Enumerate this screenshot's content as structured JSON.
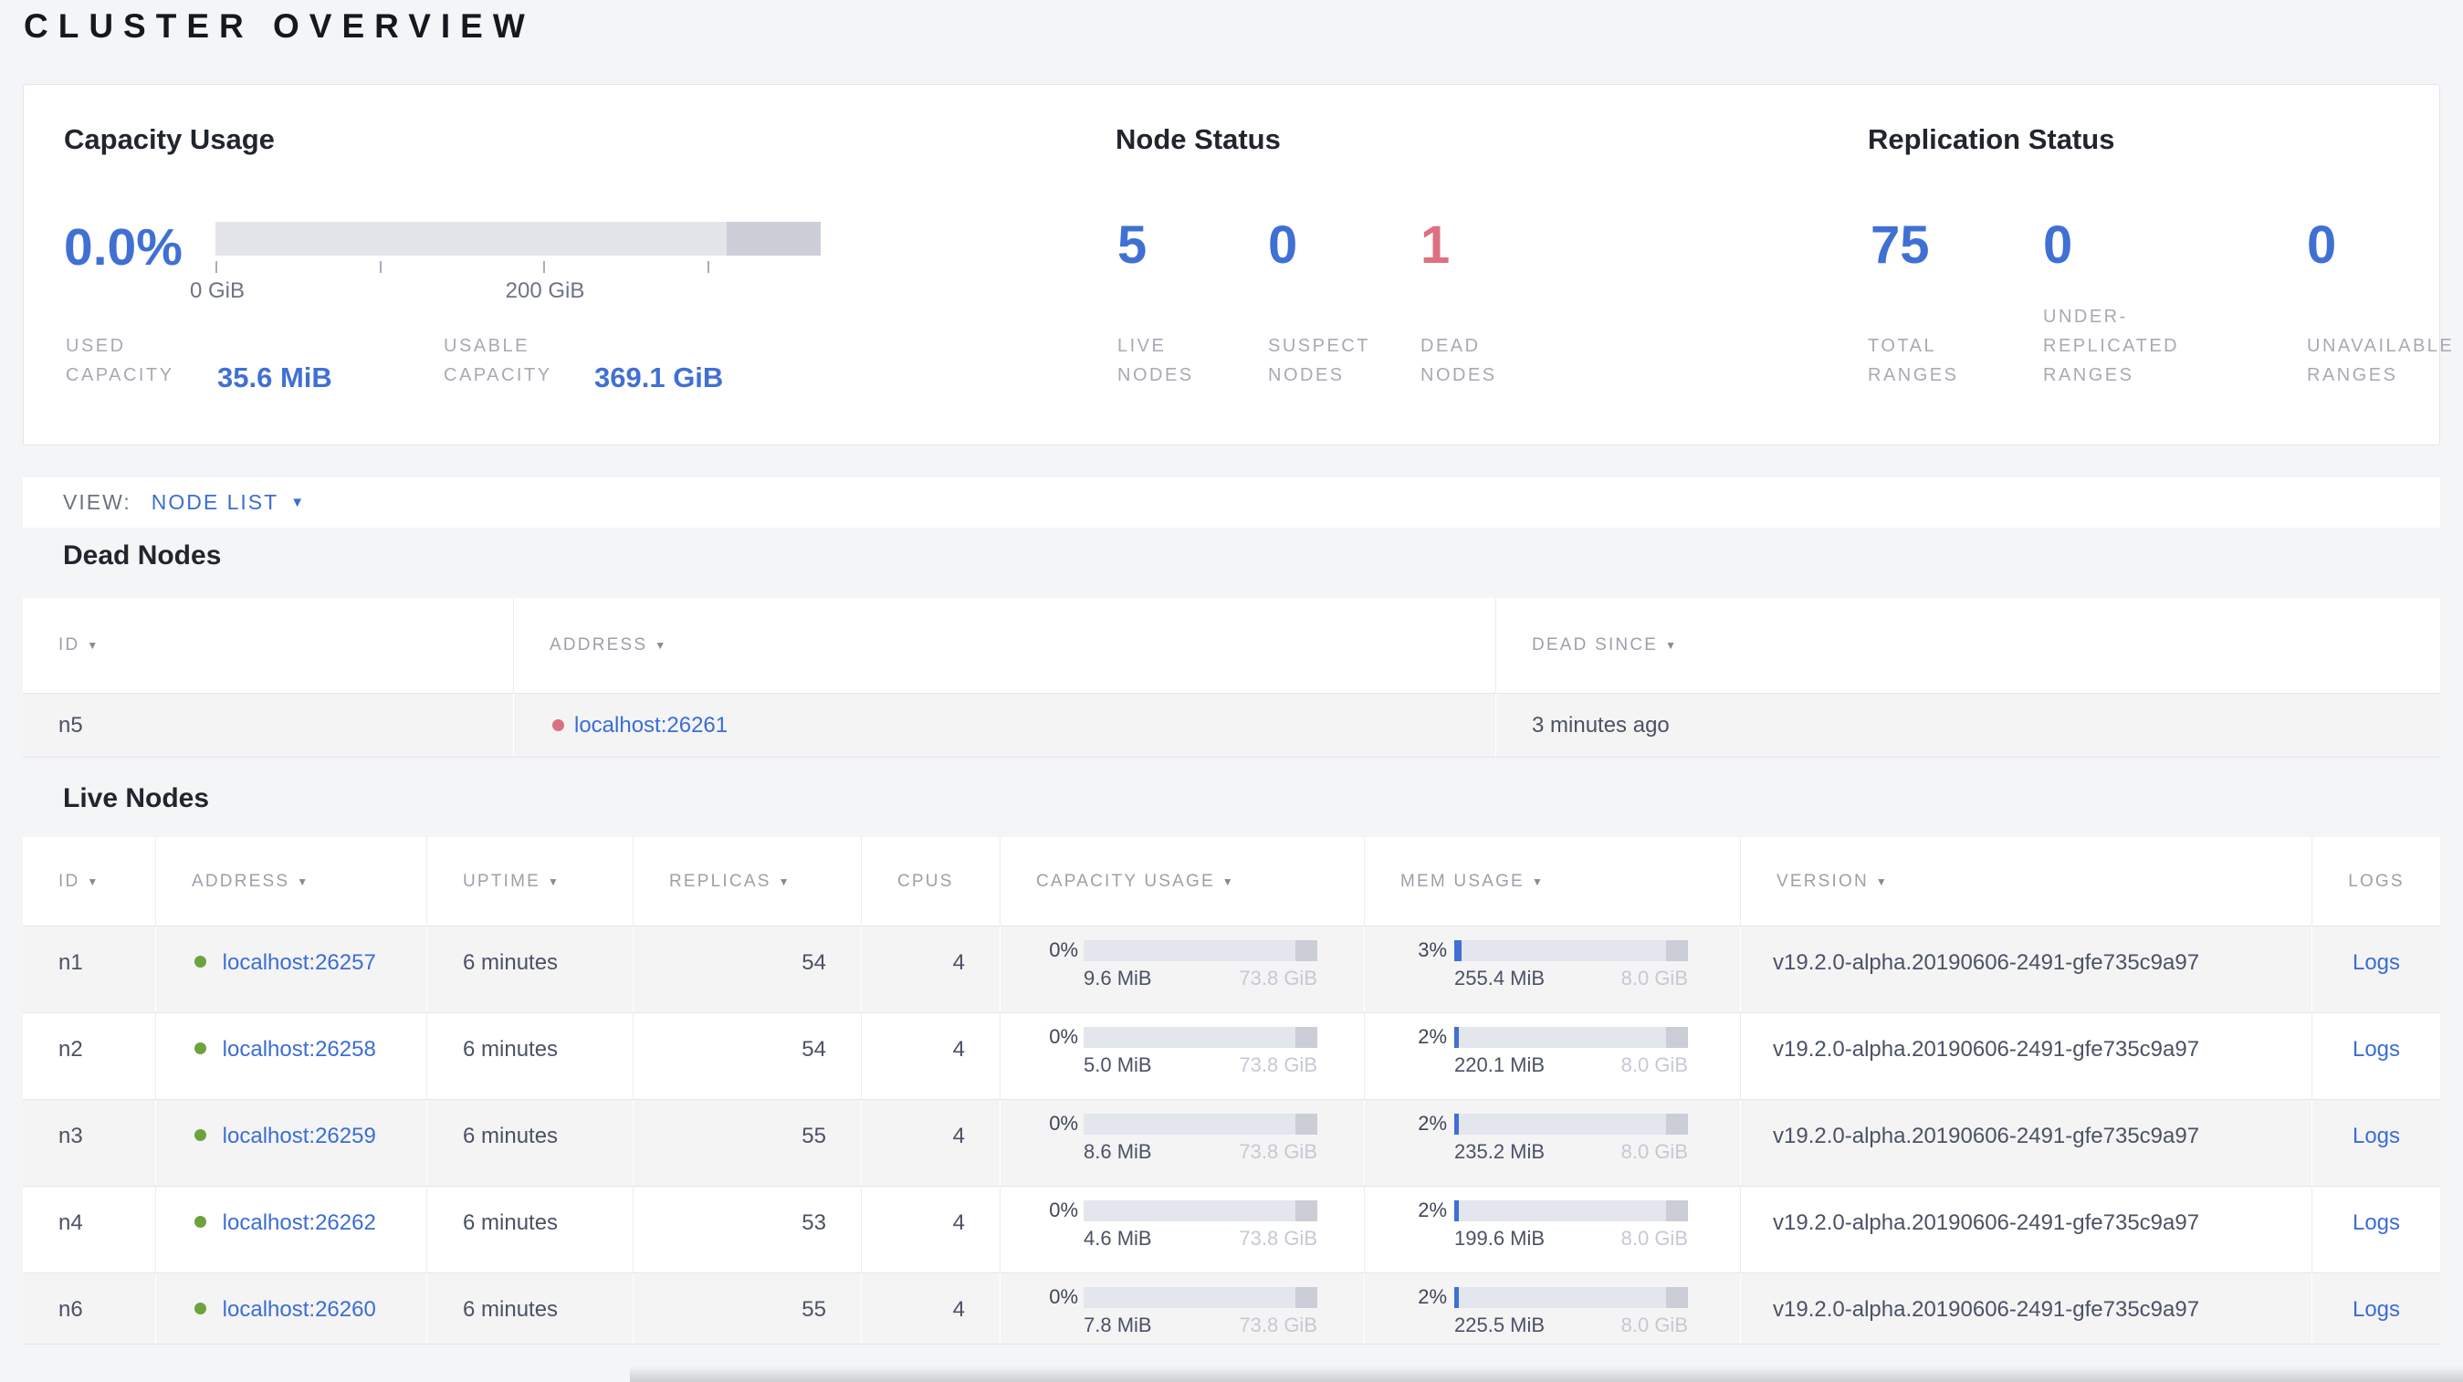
{
  "page_title": "CLUSTER OVERVIEW",
  "icons": {
    "sort_arrow": "▼",
    "dropdown_caret": "▼"
  },
  "colors": {
    "accent_blue": "#4070d4",
    "link_blue": "#3b6dd4",
    "dead_red": "#dd7080",
    "live_green": "#6da33c"
  },
  "summary": {
    "capacity": {
      "title": "Capacity Usage",
      "percent": "0.0%",
      "tick_labels": [
        "0 GiB",
        "200 GiB"
      ],
      "used": {
        "label": "USED CAPACITY",
        "value": "35.6 MiB"
      },
      "usable": {
        "label": "USABLE CAPACITY",
        "value": "369.1 GiB"
      }
    },
    "node_status": {
      "title": "Node Status",
      "live": {
        "value": "5",
        "label": "LIVE NODES"
      },
      "suspect": {
        "value": "0",
        "label": "SUSPECT NODES"
      },
      "dead": {
        "value": "1",
        "label": "DEAD NODES"
      }
    },
    "replication": {
      "title": "Replication Status",
      "total": {
        "value": "75",
        "label": "TOTAL RANGES"
      },
      "under_replicated": {
        "value": "0",
        "label": "UNDER-REPLICATED RANGES"
      },
      "unavailable": {
        "value": "0",
        "label": "UNAVAILABLE RANGES"
      }
    }
  },
  "view_bar": {
    "label": "VIEW:",
    "selected": "NODE LIST"
  },
  "dead_nodes": {
    "heading": "Dead Nodes",
    "columns": {
      "id": "ID",
      "address": "ADDRESS",
      "dead_since": "DEAD SINCE"
    },
    "rows": [
      {
        "id": "n5",
        "address": "localhost:26261",
        "dead_since": "3 minutes ago"
      }
    ]
  },
  "live_nodes": {
    "heading": "Live Nodes",
    "columns": {
      "id": "ID",
      "address": "ADDRESS",
      "uptime": "UPTIME",
      "replicas": "REPLICAS",
      "cpus": "CPUS",
      "capacity": "CAPACITY USAGE",
      "mem": "MEM USAGE",
      "version": "VERSION",
      "logs": "LOGS"
    },
    "logs_label": "Logs",
    "rows": [
      {
        "id": "n1",
        "address": "localhost:26257",
        "uptime": "6 minutes",
        "replicas": "54",
        "cpus": "4",
        "capacity": {
          "percent": "0%",
          "used": "9.6 MiB",
          "total": "73.8 GiB"
        },
        "mem": {
          "percent": "3%",
          "used": "255.4 MiB",
          "total": "8.0 GiB"
        },
        "version": "v19.2.0-alpha.20190606-2491-gfe735c9a97"
      },
      {
        "id": "n2",
        "address": "localhost:26258",
        "uptime": "6 minutes",
        "replicas": "54",
        "cpus": "4",
        "capacity": {
          "percent": "0%",
          "used": "5.0 MiB",
          "total": "73.8 GiB"
        },
        "mem": {
          "percent": "2%",
          "used": "220.1 MiB",
          "total": "8.0 GiB"
        },
        "version": "v19.2.0-alpha.20190606-2491-gfe735c9a97"
      },
      {
        "id": "n3",
        "address": "localhost:26259",
        "uptime": "6 minutes",
        "replicas": "55",
        "cpus": "4",
        "capacity": {
          "percent": "0%",
          "used": "8.6 MiB",
          "total": "73.8 GiB"
        },
        "mem": {
          "percent": "2%",
          "used": "235.2 MiB",
          "total": "8.0 GiB"
        },
        "version": "v19.2.0-alpha.20190606-2491-gfe735c9a97"
      },
      {
        "id": "n4",
        "address": "localhost:26262",
        "uptime": "6 minutes",
        "replicas": "53",
        "cpus": "4",
        "capacity": {
          "percent": "0%",
          "used": "4.6 MiB",
          "total": "73.8 GiB"
        },
        "mem": {
          "percent": "2%",
          "used": "199.6 MiB",
          "total": "8.0 GiB"
        },
        "version": "v19.2.0-alpha.20190606-2491-gfe735c9a97"
      },
      {
        "id": "n6",
        "address": "localhost:26260",
        "uptime": "6 minutes",
        "replicas": "55",
        "cpus": "4",
        "capacity": {
          "percent": "0%",
          "used": "7.8 MiB",
          "total": "73.8 GiB"
        },
        "mem": {
          "percent": "2%",
          "used": "225.5 MiB",
          "total": "8.0 GiB"
        },
        "version": "v19.2.0-alpha.20190606-2491-gfe735c9a97"
      }
    ]
  }
}
